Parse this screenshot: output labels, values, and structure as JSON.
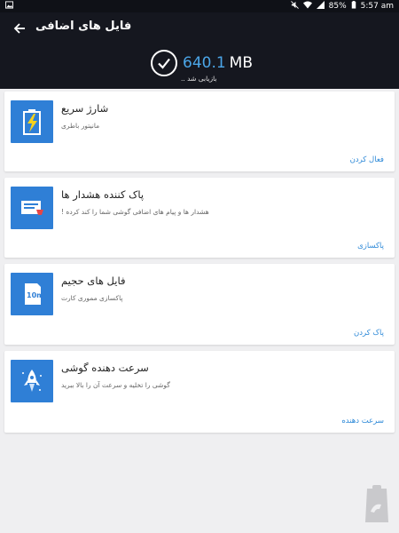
{
  "status_bar": {
    "battery": "85%",
    "time": "5:57 am"
  },
  "header": {
    "title": "فایل های اضافی",
    "amount": "640.1",
    "unit": "MB",
    "subtitle": "بازیابی شد .."
  },
  "cards": [
    {
      "title": "شارژ سریع",
      "description": "مانیتور باطری",
      "action": "فعال کردن",
      "icon": "battery-charge-icon"
    },
    {
      "title": "پاک کننده هشدار ها",
      "description": "هشدار ها و پیام های اضافی گوشی شما را کند کرده !",
      "action": "پاکسازی",
      "icon": "notification-card-icon"
    },
    {
      "title": "فایل های حجیم",
      "description": "پاکسازی مموری کارت",
      "action": "پاک کردن",
      "icon": "sd-card-icon"
    },
    {
      "title": "سرعت دهنده گوشی",
      "description": "گوشی را تخلیه و سرعت آن را بالا ببرید",
      "action": "سرعت دهنده",
      "icon": "rocket-icon"
    }
  ],
  "card_icon_inner": {
    "sd_label": "10m"
  },
  "colors": {
    "header_bg": "#15171f",
    "accent": "#4ba6e8",
    "icon_bg": "#2f7fd6",
    "action_text": "#2f8ad8"
  }
}
